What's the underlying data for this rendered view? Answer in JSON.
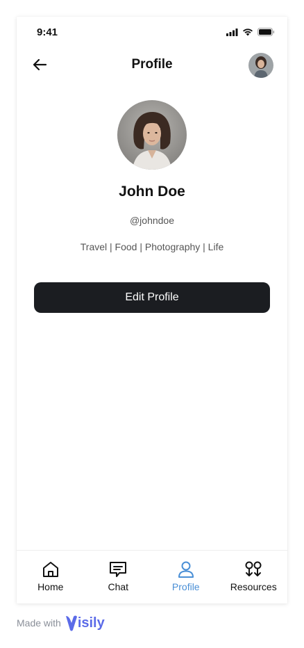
{
  "status": {
    "time": "9:41"
  },
  "header": {
    "title": "Profile"
  },
  "profile": {
    "name": "John Doe",
    "handle": "@johndoe",
    "interests": "Travel | Food | Photography | Life"
  },
  "actions": {
    "edit_label": "Edit Profile"
  },
  "tabs": [
    {
      "label": "Home",
      "icon": "home-icon"
    },
    {
      "label": "Chat",
      "icon": "chat-icon"
    },
    {
      "label": "Profile",
      "icon": "user-icon",
      "active": true
    },
    {
      "label": "Resources",
      "icon": "resources-icon"
    }
  ],
  "footer": {
    "text": "Made with",
    "brand": "isily"
  },
  "colors": {
    "accent": "#4a8fd6",
    "button": "#1b1d21",
    "brand": "#5b6be8"
  }
}
